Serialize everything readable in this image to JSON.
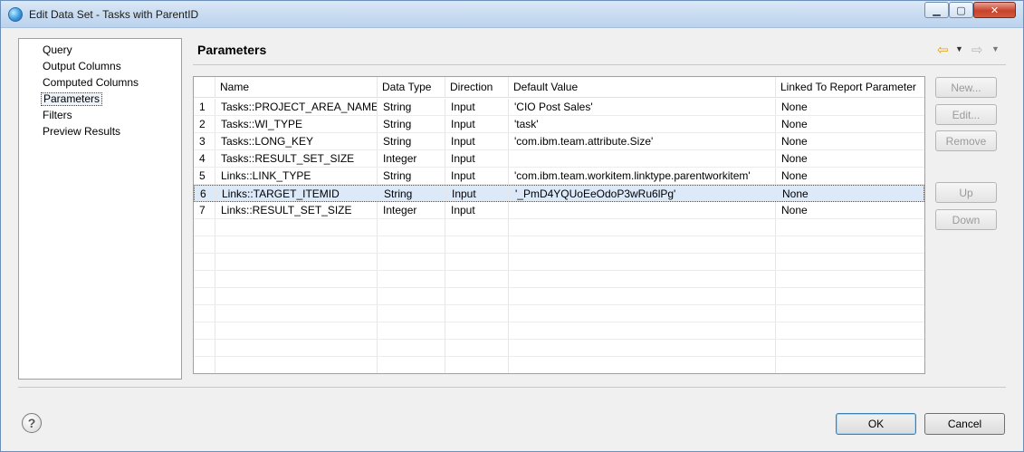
{
  "window": {
    "title": "Edit Data Set - Tasks with ParentID",
    "minimize_glyph": "▁",
    "maximize_glyph": "▢",
    "close_glyph": "✕"
  },
  "nav": {
    "items": [
      {
        "label": "Query",
        "selected": false
      },
      {
        "label": "Output Columns",
        "selected": false
      },
      {
        "label": "Computed Columns",
        "selected": false
      },
      {
        "label": "Parameters",
        "selected": true
      },
      {
        "label": "Filters",
        "selected": false
      },
      {
        "label": "Preview Results",
        "selected": false
      }
    ]
  },
  "header": {
    "title": "Parameters",
    "back_glyph": "⇦",
    "forward_glyph": "⇨",
    "dropdown_glyph": "▼"
  },
  "table": {
    "columns": [
      "",
      "Name",
      "Data Type",
      "Direction",
      "Default Value",
      "Linked To Report Parameter"
    ],
    "rows": [
      [
        "1",
        "Tasks::PROJECT_AREA_NAME",
        "String",
        "Input",
        "'CIO Post Sales'",
        "None"
      ],
      [
        "2",
        "Tasks::WI_TYPE",
        "String",
        "Input",
        "'task'",
        "None"
      ],
      [
        "3",
        "Tasks::LONG_KEY",
        "String",
        "Input",
        "'com.ibm.team.attribute.Size'",
        "None"
      ],
      [
        "4",
        "Tasks::RESULT_SET_SIZE",
        "Integer",
        "Input",
        "",
        "None"
      ],
      [
        "5",
        "Links::LINK_TYPE",
        "String",
        "Input",
        "'com.ibm.team.workitem.linktype.parentworkitem'",
        "None"
      ],
      [
        "6",
        "Links::TARGET_ITEMID",
        "String",
        "Input",
        "'_PmD4YQUoEeOdoP3wRu6lPg'",
        "None"
      ],
      [
        "7",
        "Links::RESULT_SET_SIZE",
        "Integer",
        "Input",
        "",
        "None"
      ]
    ],
    "selected_row": 6
  },
  "side_buttons": {
    "new": "New...",
    "edit": "Edit...",
    "remove": "Remove",
    "up": "Up",
    "down": "Down"
  },
  "footer": {
    "help_glyph": "?",
    "ok": "OK",
    "cancel": "Cancel"
  }
}
